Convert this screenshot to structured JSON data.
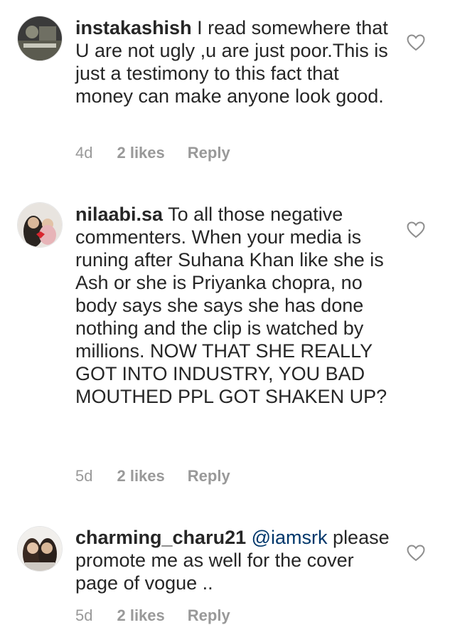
{
  "comments": [
    {
      "username": "instakashish",
      "mention": "",
      "text": "I read somewhere that U are not ugly ,u are just poor.This is just a testimony to this fact that money can make anyone look good.",
      "time": "4d",
      "likes": "2 likes",
      "reply": "Reply"
    },
    {
      "username": "nilaabi.sa",
      "mention": "",
      "text": "To all those negative commenters. When your media is runing after Suhana  Khan like she is Ash or she is Priyanka chopra, no body says she says she has done nothing and the clip is watched by millions. NOW THAT SHE REALLY GOT INTO INDUSTRY, YOU BAD MOUTHED PPL GOT SHAKEN UP?",
      "time": "5d",
      "likes": "2 likes",
      "reply": "Reply"
    },
    {
      "username": "charming_charu21",
      "mention": "@iamsrk",
      "text": "please promote me as well for the cover page of vogue ..",
      "time": "5d",
      "likes": "2 likes",
      "reply": "Reply"
    }
  ],
  "icons": {
    "like": "heart-outline-icon"
  },
  "colors": {
    "text": "#262626",
    "meta": "#999999",
    "mention": "#00376b"
  }
}
